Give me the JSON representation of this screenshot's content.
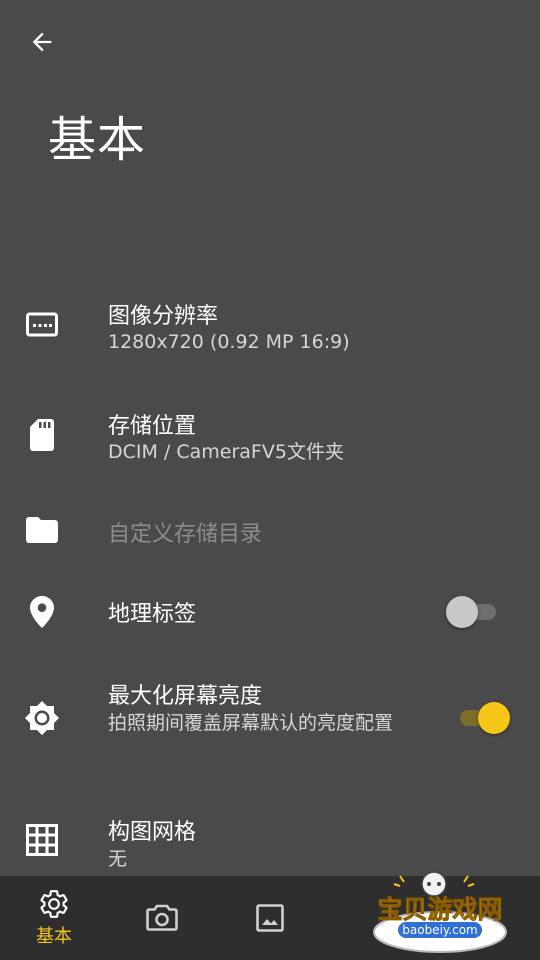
{
  "header": {
    "title": "基本"
  },
  "settings": [
    {
      "key": "resolution",
      "title": "图像分辨率",
      "subtitle": "1280x720 (0.92 MP 16:9)",
      "icon": "resolution-icon"
    },
    {
      "key": "storage",
      "title": "存储位置",
      "subtitle": "DCIM / CameraFV5文件夹",
      "icon": "sd-card-icon"
    },
    {
      "key": "custom_dir",
      "title": "自定义存储目录",
      "icon": "folder-icon",
      "enabled": false
    },
    {
      "key": "geotag",
      "title": "地理标签",
      "icon": "location-pin-icon",
      "toggle": "off"
    },
    {
      "key": "max_brightness",
      "title": "最大化屏幕亮度",
      "subtitle": "拍照期间覆盖屏幕默认的亮度配置",
      "icon": "brightness-icon",
      "toggle": "on"
    },
    {
      "key": "grid",
      "title": "构图网格",
      "subtitle": "无",
      "icon": "grid-icon"
    }
  ],
  "bottom_nav": {
    "items": [
      {
        "key": "basic",
        "label": "基本",
        "icon": "gear-icon",
        "active": true
      },
      {
        "key": "camera",
        "icon": "camera-icon",
        "active": false
      },
      {
        "key": "gallery",
        "icon": "image-icon",
        "active": false
      }
    ]
  },
  "watermark": {
    "text": "宝贝游戏网",
    "url": "baobeiy.com"
  },
  "colors": {
    "background": "#4a4a4a",
    "accent": "#f5c518",
    "bottom_bar": "#2e2e2e"
  }
}
